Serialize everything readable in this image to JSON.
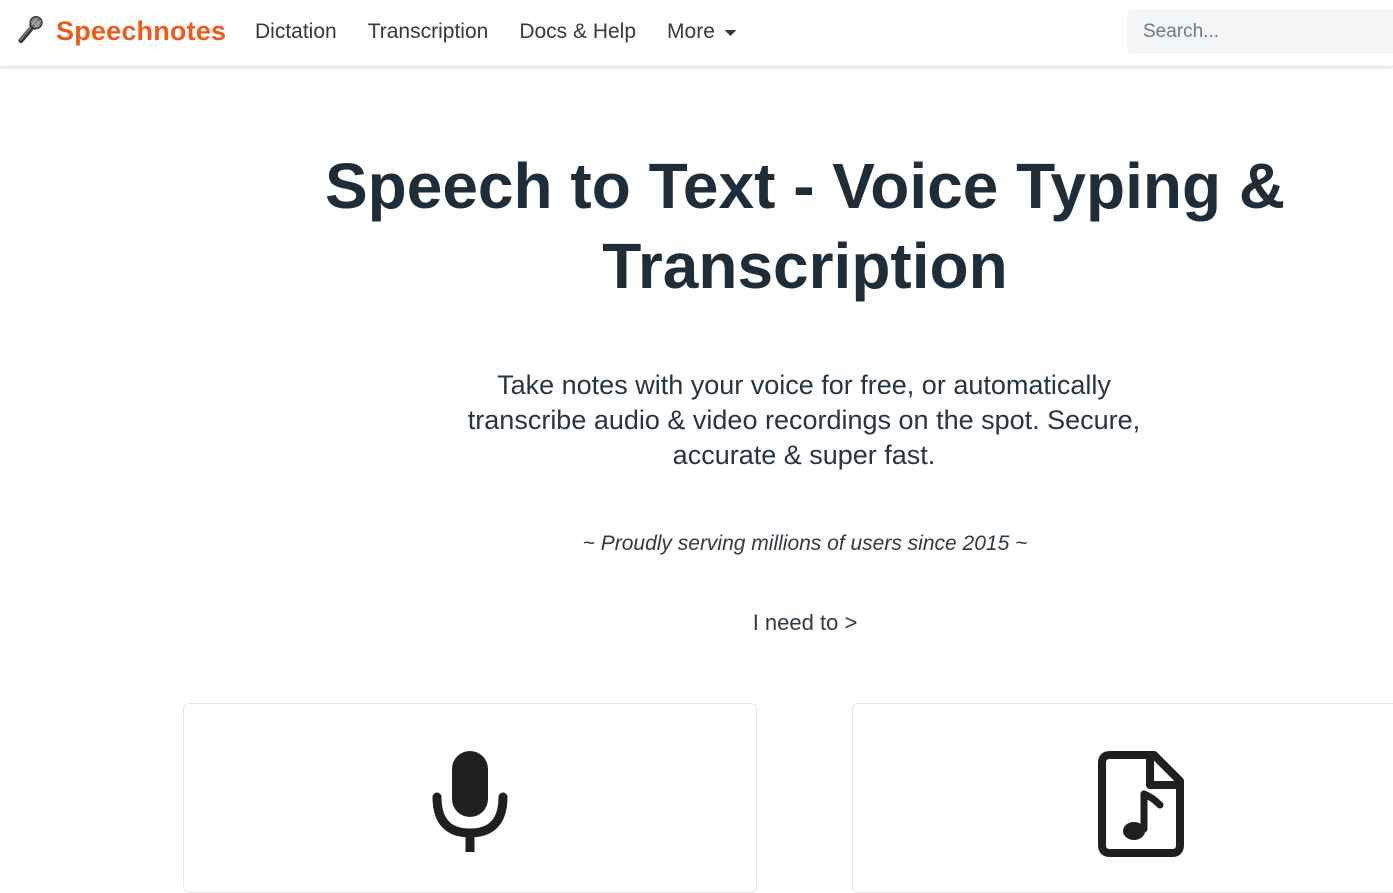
{
  "brand": {
    "name": "Speechnotes",
    "icon": "microphone-icon",
    "color": "#f05a1a"
  },
  "nav": {
    "items": [
      {
        "label": "Dictation"
      },
      {
        "label": "Transcription"
      },
      {
        "label": "Docs & Help"
      },
      {
        "label": "More",
        "icon": "chevron-down-icon"
      }
    ]
  },
  "search": {
    "placeholder": "Search...",
    "value": ""
  },
  "hero": {
    "title": "Speech to Text - Voice Typing & Transcription",
    "subtitle": "Take notes with your voice for free, or automatically transcribe audio & video recordings on the spot. Secure, accurate & super fast.",
    "tagline": "~ Proudly serving millions of users since 2015 ~",
    "prompt": "I need to >"
  },
  "cards": [
    {
      "icon": "microphone-icon"
    },
    {
      "icon": "audio-file-icon"
    }
  ],
  "colors": {
    "text": "#1f2d38",
    "accent": "#f05a1a",
    "search_bg": "#f3f5f6"
  }
}
